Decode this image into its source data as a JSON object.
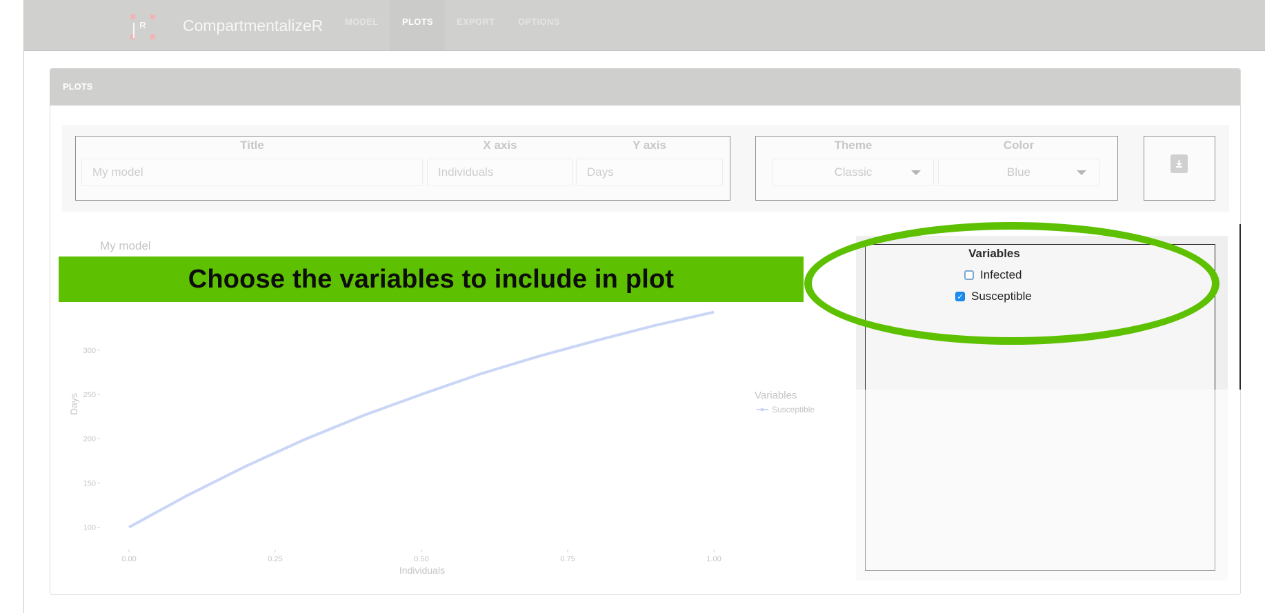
{
  "app": {
    "brand": "CompartmentalizeR",
    "logo_letter": "R",
    "nav": [
      "MODEL",
      "PLOTS",
      "EXPORT",
      "OPTIONS"
    ],
    "active_nav": "PLOTS"
  },
  "panel": {
    "title": "PLOTS"
  },
  "controls": {
    "title_label": "Title",
    "title_value": "My model",
    "xaxis_label": "X axis",
    "xaxis_value": "Individuals",
    "yaxis_label": "Y axis",
    "yaxis_value": "Days",
    "theme_label": "Theme",
    "theme_value": "Classic",
    "color_label": "Color",
    "color_value": "Blue",
    "download_icon": "download-icon"
  },
  "variables": {
    "title": "Variables",
    "items": [
      {
        "label": "Infected",
        "checked": false
      },
      {
        "label": "Susceptible",
        "checked": true
      }
    ]
  },
  "annotation": {
    "text": "Choose the variables to include in plot",
    "color": "#5dc000"
  },
  "chart_data": {
    "type": "line",
    "title": "My model",
    "xlabel": "Individuals",
    "ylabel": "Days",
    "xlim": [
      0,
      1
    ],
    "ylim": [
      88,
      345
    ],
    "x_ticks": [
      "0.00",
      "0.25",
      "0.50",
      "0.75",
      "1.00"
    ],
    "y_ticks": [
      "100",
      "150",
      "200",
      "250",
      "300"
    ],
    "legend_title": "Variables",
    "legend_placement": "right",
    "series": [
      {
        "name": "Susceptible",
        "color": "#c9d6f6",
        "x": [
          0.0,
          0.1,
          0.2,
          0.3,
          0.4,
          0.5,
          0.6,
          0.7,
          0.8,
          0.9,
          1.0
        ],
        "y": [
          100,
          136,
          169,
          199,
          226,
          250,
          273,
          293,
          311,
          328,
          343
        ]
      }
    ]
  }
}
